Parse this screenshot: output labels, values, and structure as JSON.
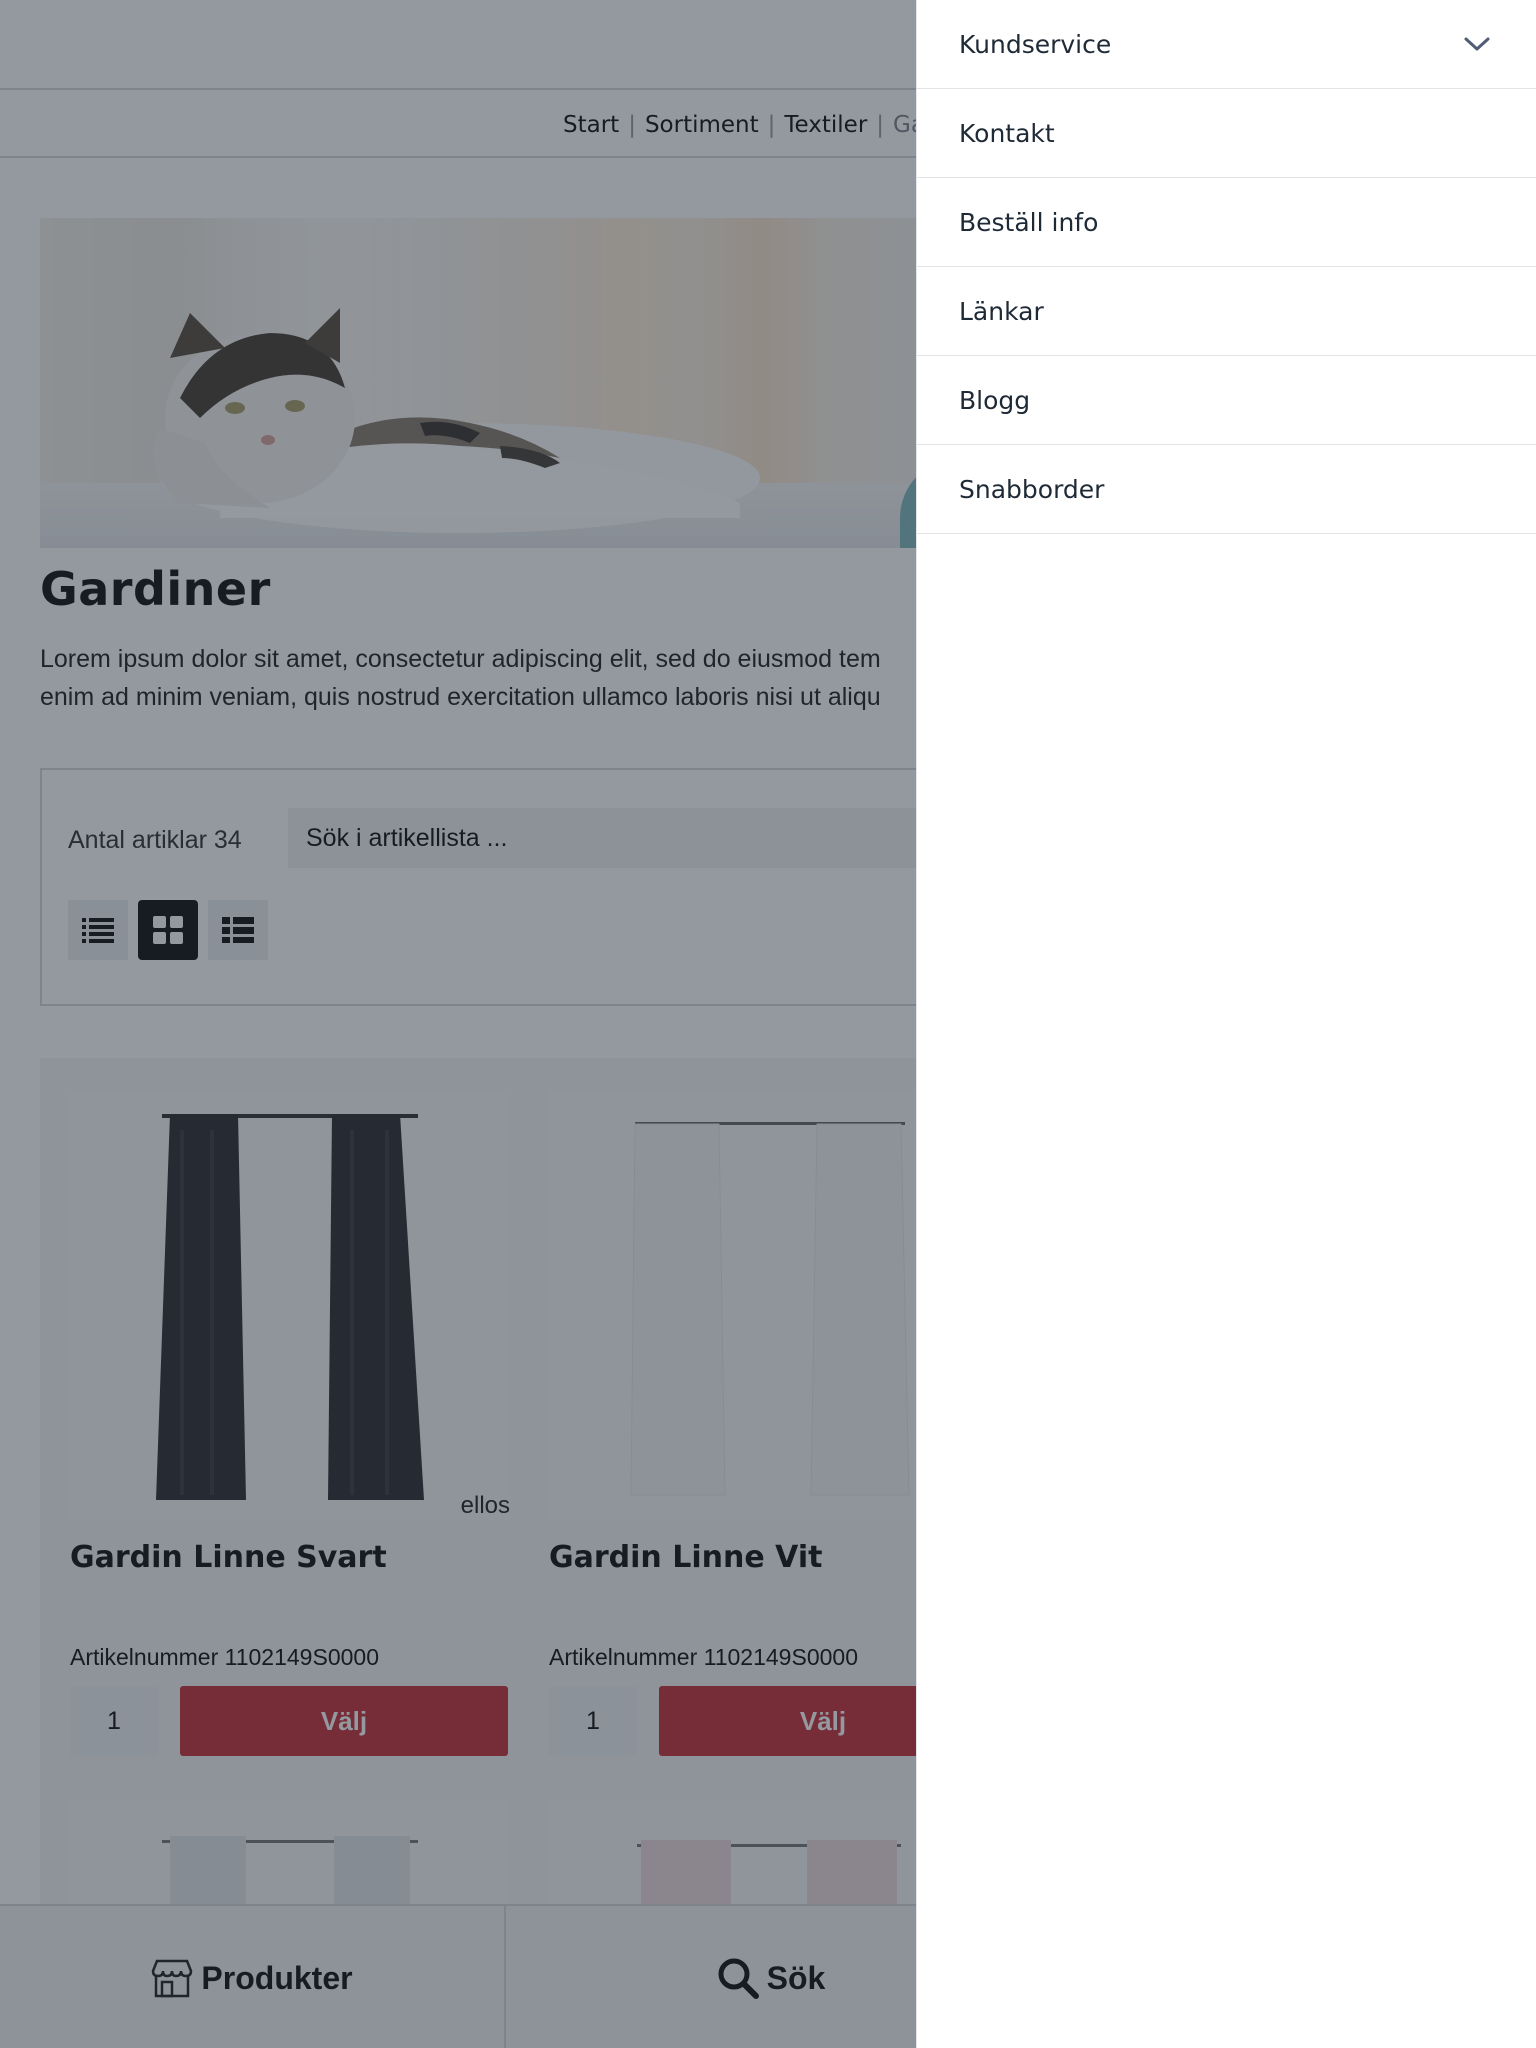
{
  "breadcrumb": {
    "start": "Start",
    "sortiment": "Sortiment",
    "textiler": "Textiler",
    "current": "Gar",
    "sep": "|"
  },
  "category": {
    "title": "Gardiner",
    "intro_line1": "Lorem ipsum dolor sit amet, consectetur adipiscing elit, sed do eiusmod tem",
    "intro_line2": "enim ad minim veniam, quis nostrud exercitation ullamco laboris nisi ut aliqu"
  },
  "filters": {
    "count_label": "Antal artiklar 34",
    "search_placeholder": "Sök i artikellista ...",
    "view_modes": [
      "list-view-icon",
      "grid-view-icon",
      "compact-list-view-icon"
    ],
    "active_view": "grid-view-icon"
  },
  "products": [
    {
      "name": "Gardin Linne Svart",
      "article": "Artikelnummer 1102149S0000",
      "qty": "1",
      "button": "Välj",
      "brand": "ellos"
    },
    {
      "name": "Gardin Linne Vit",
      "article": "Artikelnummer 1102149S0000",
      "qty": "1",
      "button": "Välj"
    }
  ],
  "bottom_nav": {
    "products": "Produkter",
    "search": "Sök"
  },
  "drawer": {
    "items": [
      {
        "label": "Kundservice",
        "expandable": true
      },
      {
        "label": "Kontakt"
      },
      {
        "label": "Beställ info"
      },
      {
        "label": "Länkar"
      },
      {
        "label": "Blogg"
      },
      {
        "label": "Snabborder"
      }
    ]
  },
  "colors": {
    "overlay": "#1f2937",
    "buy_button": "#c8313b",
    "drawer_text": "#1f2a37"
  }
}
